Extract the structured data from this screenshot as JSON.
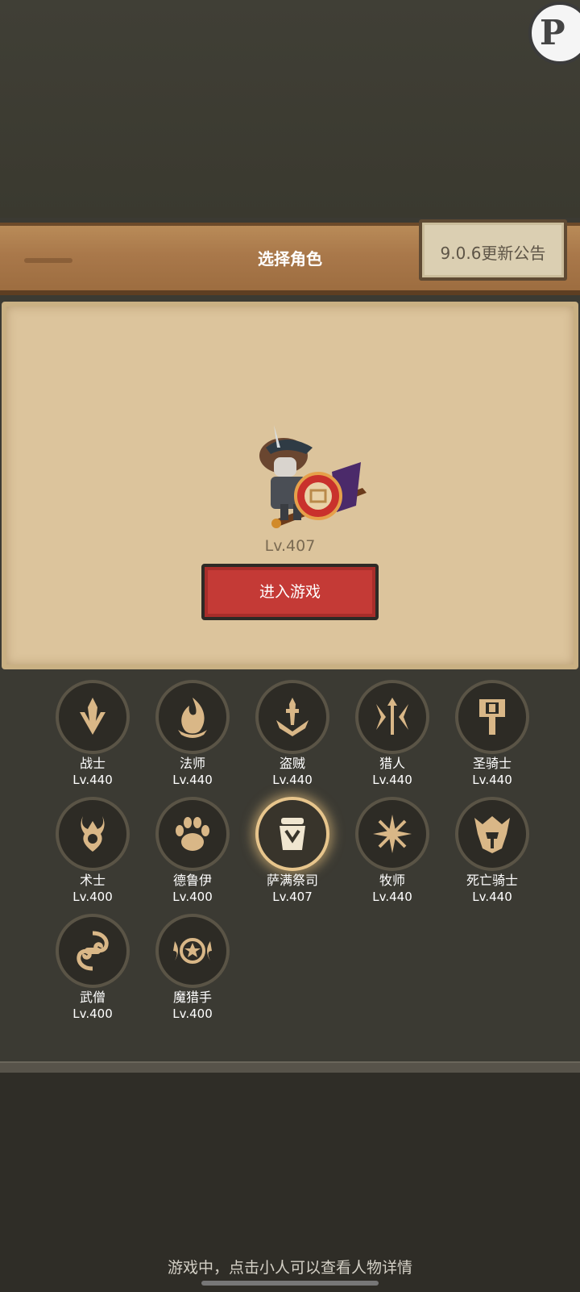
{
  "header": {
    "title": "选择角色"
  },
  "notice": {
    "label": "9.0.6更新公告"
  },
  "corner_badge": {
    "glyph": "P"
  },
  "hero": {
    "level": "Lv.407"
  },
  "enter_button": {
    "label": "进入游戏"
  },
  "classes": [
    {
      "name": "战士",
      "level": "Lv.440",
      "icon": "sword-icon"
    },
    {
      "name": "法师",
      "level": "Lv.440",
      "icon": "flame-icon"
    },
    {
      "name": "盗贼",
      "level": "Lv.440",
      "icon": "daggers-icon"
    },
    {
      "name": "猎人",
      "level": "Lv.440",
      "icon": "arrows-icon"
    },
    {
      "name": "圣骑士",
      "level": "Lv.440",
      "icon": "hammer-icon"
    },
    {
      "name": "术士",
      "level": "Lv.400",
      "icon": "demon-icon"
    },
    {
      "name": "德鲁伊",
      "level": "Lv.400",
      "icon": "paw-icon"
    },
    {
      "name": "萨满祭司",
      "level": "Lv.407",
      "icon": "totem-icon",
      "selected": true
    },
    {
      "name": "牧师",
      "level": "Lv.440",
      "icon": "star-burst-icon"
    },
    {
      "name": "死亡骑士",
      "level": "Lv.440",
      "icon": "helmet-icon"
    },
    {
      "name": "武僧",
      "level": "Lv.400",
      "icon": "swirl-icon"
    },
    {
      "name": "魔猎手",
      "level": "Lv.400",
      "icon": "demon-eye-icon"
    }
  ],
  "footer": {
    "hint": "游戏中，点击小人可以查看人物详情"
  },
  "colors": {
    "gold": "#d9b787",
    "enter_red": "#c43a36",
    "parchment": "#dcc49c"
  }
}
